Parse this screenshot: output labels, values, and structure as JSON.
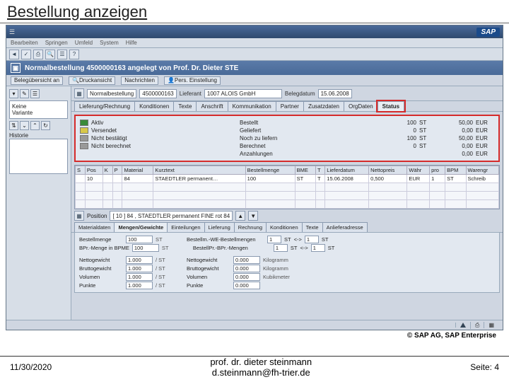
{
  "slide": {
    "title": "Bestellung anzeigen",
    "credit": "© SAP AG, SAP Enterprise",
    "date": "11/30/2020",
    "author_line1": "prof. dr. dieter steinmann",
    "author_line2": "d.steinmann@fh-trier.de",
    "page": "Seite: 4"
  },
  "sap": {
    "logo": "SAP",
    "menu": [
      "Bearbeiten",
      "Springen",
      "Umfeld",
      "System",
      "Hilfe"
    ],
    "doc_header": "Normalbestellung 4500000163 angelegt von Prof. Dr. Dieter STE",
    "subbar": {
      "a": "Belegübersicht an",
      "b": "Druckansicht",
      "c": "Nachrichten",
      "d": "Pers. Einstellung"
    },
    "left": {
      "variant_l1": "Keine",
      "variant_l2": "Variante",
      "hist": "Historie"
    },
    "order_bar": {
      "type": "Normalbestellung",
      "no": "4500000163",
      "vendor_lbl": "Lieferant",
      "vendor": "1007 ALOIS GmbH",
      "date_lbl": "Belegdatum",
      "date": "15.06.2008"
    },
    "tabs": [
      "Lieferung/Rechnung",
      "Konditionen",
      "Texte",
      "Anschrift",
      "Kommunikation",
      "Partner",
      "Zusatzdaten",
      "OrgDaten",
      "Status"
    ],
    "status": {
      "rows": [
        {
          "icon": "st-green",
          "label": "Aktiv",
          "sub": "Bestellt",
          "q": "100",
          "u": "ST",
          "amt": "50,00",
          "cur": "EUR"
        },
        {
          "icon": "st-yellow",
          "label": "Versendet",
          "sub": "Geliefert",
          "q": "0",
          "u": "ST",
          "amt": "0,00",
          "cur": "EUR"
        },
        {
          "icon": "st-gray",
          "label": "Nicht bestätigt",
          "sub": "Noch zu liefern",
          "q": "100",
          "u": "ST",
          "amt": "50,00",
          "cur": "EUR"
        },
        {
          "icon": "st-gray",
          "label": "Nicht berechnet",
          "sub": "Berechnet",
          "q": "0",
          "u": "ST",
          "amt": "0,00",
          "cur": "EUR"
        },
        {
          "icon": "",
          "label": "",
          "sub": "Anzahlungen",
          "q": "",
          "u": "",
          "amt": "0,00",
          "cur": "EUR"
        }
      ]
    },
    "grid": {
      "cols": [
        "S",
        "Pos",
        "K",
        "P",
        "Material",
        "Kurztext",
        "Bestellmenge",
        "BME",
        "T",
        "Lieferdatum",
        "Nettopreis",
        "Währ",
        "pro",
        "BPM",
        "Warengr"
      ],
      "row": {
        "pos": "10",
        "mat": "84",
        "txt": "STAEDTLER permanent…",
        "qty": "100",
        "bme": "ST",
        "typ": "T",
        "date": "15.06.2008",
        "price": "0,500",
        "cur": "EUR",
        "per": "1",
        "bpm": "ST",
        "grp": "Schreib"
      }
    },
    "pos": {
      "label": "Position",
      "value": "[ 10 ] 84 , STAEDTLER permanent FINE rot 84"
    },
    "dtabs": [
      "Materialdaten",
      "Mengen/Gewichte",
      "Einteilungen",
      "Lieferung",
      "Rechnung",
      "Konditionen",
      "Texte",
      "Anlieferadresse"
    ],
    "dform": {
      "row1": {
        "l1": "Bestellmenge",
        "v1": "100",
        "u1": "ST",
        "l2": "Bestellm.-WE-Bestellmengen",
        "v2": "1",
        "u2": "ST",
        "sep": "<->",
        "v3": "1",
        "u3": "ST"
      },
      "row2": {
        "l1": "BPr.-Menge in BPME",
        "v1": "100",
        "u1": "ST",
        "l2": "BestellPr.-BPr.-Mengen",
        "v2": "1",
        "u2": "ST",
        "sep": "<->",
        "v3": "1",
        "u3": "ST"
      },
      "row3": {
        "l1": "Nettogewicht",
        "v1": "1.000",
        "u1": "",
        "l2": "/ ST",
        "l3": "Nettogewicht",
        "v3": "0.000",
        "u3": "Kilogramm"
      },
      "row4": {
        "l1": "Bruttogewicht",
        "v1": "1.000",
        "u1": "",
        "l2": "/ ST",
        "l3": "Bruttogewicht",
        "v3": "0.000",
        "u3": "Kilogramm"
      },
      "row5": {
        "l1": "Volumen",
        "v1": "1.000",
        "u1": "",
        "l2": "/ ST",
        "l3": "Volumen",
        "v3": "0.000",
        "u3": "Kubikmeter"
      },
      "row6": {
        "l1": "Punkte",
        "v1": "1.000",
        "u1": "",
        "l2": "/ ST",
        "l3": "Punkte",
        "v3": "0.000",
        "u3": ""
      }
    },
    "statusbar": {
      "sys": "",
      "mode": ""
    }
  }
}
